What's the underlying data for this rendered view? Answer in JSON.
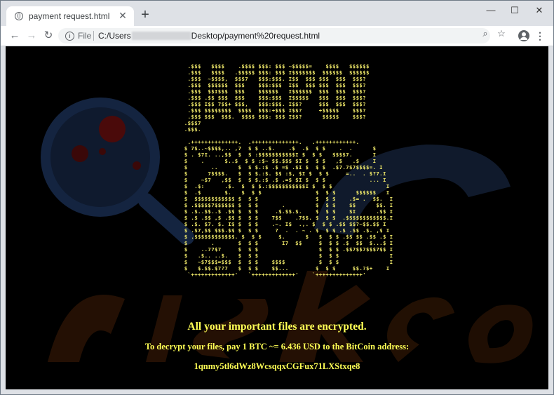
{
  "tab": {
    "title": "payment request.html",
    "close_glyph": "✕"
  },
  "newtab_glyph": "+",
  "window_controls": {
    "minimize": "—",
    "maximize": "☐",
    "close": "✕"
  },
  "nav": {
    "back": "←",
    "forward": "→",
    "reload": "↻"
  },
  "address": {
    "scheme": "File",
    "url_prefix": "C:/Users",
    "url_suffix": "Desktop/payment%20request.html"
  },
  "icons": {
    "info": "i",
    "zoom": "⌕",
    "star": "☆",
    "menu": "⋮"
  },
  "page": {
    "ascii_art": "  .$$$   $$$$    .$$$$ $$$: $$$ ~$$$$$=    $$$$   $$$$$$\n  .$$$   $$$$   .$$$$$ $$$: $$$ I$$$$$$$  $$$$$$  $$$$$$\n  .$$$  ~$$$$,  $$$7   $$$:$$$. I$$  $$$ $$$  $$$  $$$?\n  .$$$  $$$$$$  $$$    $$$:$$$  I$$  $$$ $$$  $$$  $$$?\n  .$$$  $$I$$$  $$$    $$$$$$   I$$$$$$  $$$  $$$  $$$?\n  .$$$ .$$ $$$  $$$    $$$:$$$  I$$$$$   $$$  $$$  $$$?\n  .$$$ I$$ 7$$+ $$$,   $$$:$$$. I$$?     $$$  $$$  $$$?\n  .$$$ $$$$$$$$  $$$$  $$$:+$$$ I$$?     +$$$$$    $$$?\n  .$$$ $$$  $$$.  $$$$ $$$: $$$ I$$?      $$$$$    $$$?\n .$$$7\n .$$$.\n\n  .++++++++++++++.  .++++++++++++++.   .++++++++++++.\n $ 7$..~$$$$,.. ,7  $ $ ..$.    .$  .$  $ $    .  .      $\n $ . $7I. ..,$$  $  $ :$$$$$$$$$$$I $  $ $   $$$$7.      I\n $    .      $..$  $ $ :$~ $$.$$$ $I $  $ $   ,$   .$    I\n $       ..      $  $ $.:$ .$ =$ .$I $  $ $  .$7.7$7$$$$=. I\n $      7$$$$.   $  $ $.:$. $$ :$, $I $  $ $     =..  . $?7.I\n $    ~$7   ,$$  $  $ $.:$ .$ .=$ $I $  $ $             ... I\n $  .$:      .$.  $  $ $.:$$$$$$$$$$$I $  $ $                I\n $  .$       $.   $  $ $                $  $ $      $$$$$$   I\n $  $$$$$$$$$$$$ $  $ $                 $  $ $    .$= .  $$.  I\n $ .$$$$$7$$$$$$ $  $ $       .         $  $ $    $$      $$. I\n $ .$..$$..$ .$$ $  $ $     .$.$$.$.    $  $ $    $I      .$$ I\n $ .$ .$$ ,$ .$$ $  $ $    7$$    .7$$. $  $ $  .$$$$$$$$$$$$.I\n $ .$. $7. $. I$ $  $ $    .~. I$  .,. $  $ $ .$$ $$?~$$.$$ I\n $ .$7,$$ $$$.$$ $  $ $     ?  .  . ~ . $  $ $ .$ .$$ .$. ,$ I\n $ .$$$$$$$$$$$$. $  $ $     $.      $   $  $ $ .$$ $$ .$$ .$ I\n $       .       $  $ $       I7  $$     $  $ $ .$  $$  $...$ I\n $    ..77$7     $  $ $                  $  $ $ .$$7$$7$$$7$$ I\n $   .$.. ..$.   $  $ $                  $  $ $               I\n $   ~$7$$$=$$$  $  $ $    $$$$          $  $ $               I\n $   $.$$.$7?7   $  $ $    $$...        $  $ $     $$.?$+    I\n  `+++++++++++++'   `+++++++++++++'    `++++++++++++++'",
    "headline": "All your important files are encrypted.",
    "instruction": "To decrypt your files, pay 1 BTC ~= 6.436 USD to the BitCoin address:",
    "btc_address": "1qnmy5tl6dWz8WcsqqxCGFux71LXStxqe8"
  }
}
